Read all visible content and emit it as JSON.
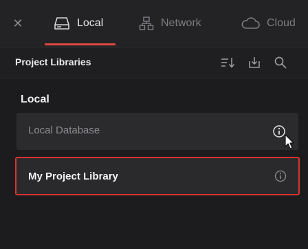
{
  "tabs": {
    "close_icon": "close-icon",
    "items": [
      {
        "label": "Local",
        "icon": "drive-icon",
        "active": true
      },
      {
        "label": "Network",
        "icon": "network-icon",
        "active": false
      },
      {
        "label": "Cloud",
        "icon": "cloud-icon",
        "active": false
      }
    ],
    "accent_color": "#e0473e"
  },
  "header": {
    "title": "Project Libraries",
    "actions": [
      {
        "icon": "sort-icon"
      },
      {
        "icon": "import-icon"
      },
      {
        "icon": "search-icon"
      }
    ]
  },
  "content": {
    "group_label": "Local",
    "libraries": [
      {
        "name": "Local Database",
        "icon": "info-icon",
        "selected": false
      },
      {
        "name": "My Project Library",
        "icon": "info-icon",
        "selected": true
      }
    ],
    "selection_color": "#d9342f"
  }
}
